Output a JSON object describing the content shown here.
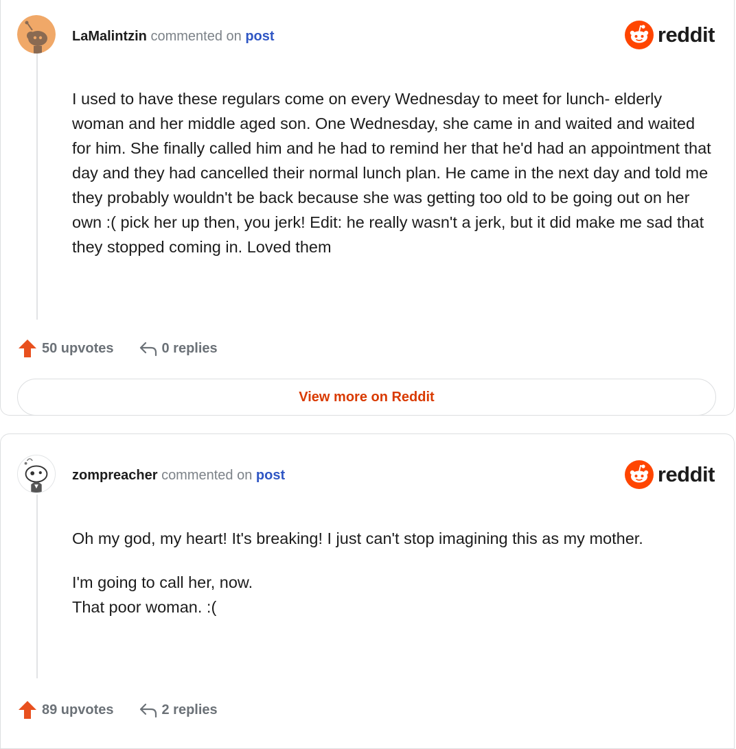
{
  "brand": {
    "wordmark": "reddit",
    "icon": "reddit-snoo-icon",
    "color": "#ff4500"
  },
  "comments": [
    {
      "author": "LaMalintzin",
      "commented_on_text": "commented on",
      "post_link": "post",
      "avatar_icon": "snoo-avatar-icon",
      "avatar_color": "#f0a868",
      "paragraphs": [
        "I used to have these regulars come on every Wednesday to meet for lunch- elderly woman and her middle aged son. One Wednesday, she came in and waited and waited for him. She finally called him and he had to remind her that he'd had an appointment that day and they had cancelled their normal lunch plan. He came in the next day and told me they probably wouldn't be back because she was getting too old to be going out on her own :( pick her up then, you jerk! Edit: he really wasn't a jerk, but it did make me sad that they stopped coming in. Loved them"
      ],
      "upvotes_label": "50 upvotes",
      "replies_label": "0 replies"
    },
    {
      "author": "zompreacher",
      "commented_on_text": "commented on",
      "post_link": "post",
      "avatar_icon": "snoo-avatar-icon",
      "avatar_color": "#ffffff",
      "paragraphs": [
        "Oh my god, my heart! It's breaking! I just can't stop imagining this as my mother.",
        "I'm going to call her, now.\nThat poor woman. :("
      ],
      "upvotes_label": "89 upvotes",
      "replies_label": "2 replies"
    }
  ],
  "view_more_label": "View more on Reddit",
  "colors": {
    "upvote": "#e8501e",
    "link": "#2f56c4",
    "view_more": "#d93a00"
  }
}
